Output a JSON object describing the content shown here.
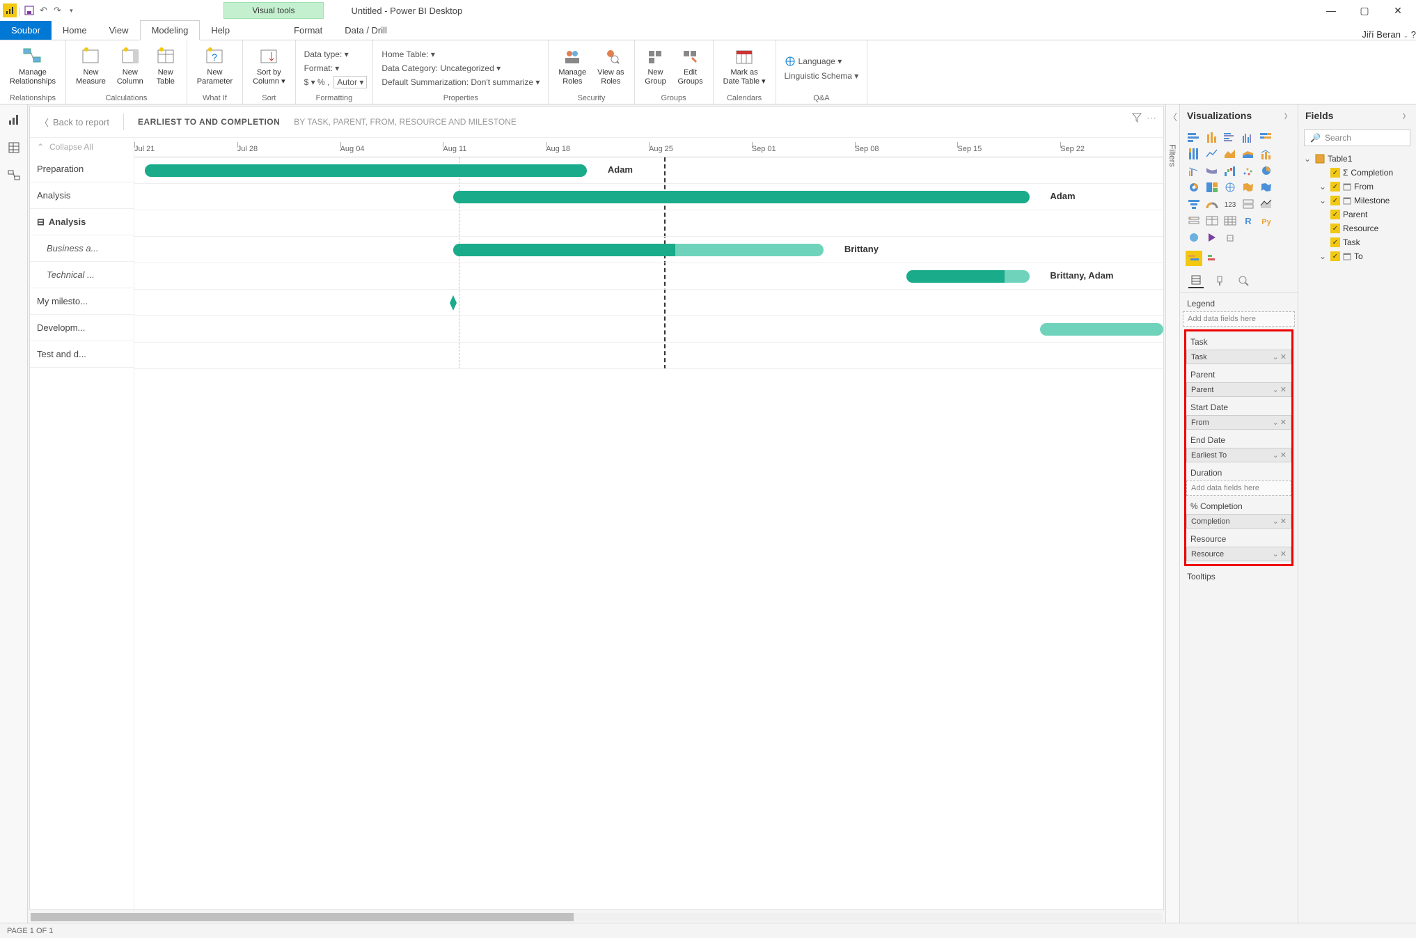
{
  "title_bar": {
    "app_title": "Untitled - Power BI Desktop",
    "visual_tools": "Visual tools",
    "user": "Jiří Beran"
  },
  "ribbon_tabs": {
    "file": "Soubor",
    "home": "Home",
    "view": "View",
    "modeling": "Modeling",
    "help": "Help",
    "format": "Format",
    "data_drill": "Data / Drill"
  },
  "ribbon": {
    "relationships": {
      "manage": "Manage\nRelationships",
      "group": "Relationships"
    },
    "calculations": {
      "new_measure": "New\nMeasure",
      "new_column": "New\nColumn",
      "new_table": "New\nTable",
      "group": "Calculations"
    },
    "whatif": {
      "new_parameter": "New\nParameter",
      "group": "What If"
    },
    "sort": {
      "sort_by_column": "Sort by\nColumn ▾",
      "group": "Sort"
    },
    "formatting": {
      "data_type": "Data type: ▾",
      "format": "Format: ▾",
      "currency_pct": "$ ▾ % , ",
      "auto": "Autor ▾",
      "group": "Formatting"
    },
    "properties": {
      "home_table": "Home Table: ▾",
      "data_category": "Data Category: Uncategorized ▾",
      "default_summarization": "Default Summarization: Don't summarize ▾",
      "group": "Properties"
    },
    "security": {
      "manage_roles": "Manage\nRoles",
      "view_as_roles": "View as\nRoles",
      "group": "Security"
    },
    "groups": {
      "new_group": "New\nGroup",
      "edit_groups": "Edit\nGroups",
      "group": "Groups"
    },
    "calendars": {
      "mark_date": "Mark as\nDate Table ▾",
      "group": "Calendars"
    },
    "qa": {
      "language": "Language ▾",
      "linguistic": "Linguistic Schema ▾",
      "group": "Q&A"
    }
  },
  "filters_label": "Filters",
  "gantt": {
    "back": "Back to report",
    "collapse": "Collapse All",
    "title": "EARLIEST TO AND COMPLETION",
    "subtitle": "BY TASK, PARENT, FROM, RESOURCE AND MILESTONE",
    "timeline": [
      "Jul 21",
      "Jul 28",
      "Aug 04",
      "Aug 11",
      "Aug 18",
      "Aug 25",
      "Sep 01",
      "Sep 08",
      "Sep 15",
      "Sep 22"
    ],
    "rows": [
      {
        "label": "Preparation",
        "type": "task"
      },
      {
        "label": "Analysis",
        "type": "task"
      },
      {
        "label": "Analysis",
        "type": "group"
      },
      {
        "label": "Business a...",
        "type": "sub"
      },
      {
        "label": "Technical ...",
        "type": "sub"
      },
      {
        "label": "My milesto...",
        "type": "task"
      },
      {
        "label": "Developm...",
        "type": "task"
      },
      {
        "label": "Test and d...",
        "type": "task"
      }
    ],
    "bar_labels": {
      "adam": "Adam",
      "brittany": "Brittany",
      "brittany_adam": "Brittany, Adam"
    }
  },
  "viz_pane": {
    "title": "Visualizations",
    "legend": "Legend",
    "add_fields": "Add data fields here",
    "tooltips": "Tooltips",
    "wells": [
      {
        "label": "Task",
        "value": "Task"
      },
      {
        "label": "Parent",
        "value": "Parent"
      },
      {
        "label": "Start Date",
        "value": "From"
      },
      {
        "label": "End Date",
        "value": "Earliest To"
      },
      {
        "label": "Duration",
        "value": null
      },
      {
        "label": "% Completion",
        "value": "Completion"
      },
      {
        "label": "Resource",
        "value": "Resource"
      }
    ]
  },
  "fields_pane": {
    "title": "Fields",
    "search_placeholder": "Search",
    "table": "Table1",
    "fields": [
      {
        "name": "Completion",
        "checked": true,
        "sigma": true,
        "expand": false
      },
      {
        "name": "From",
        "checked": true,
        "date": true,
        "expand": true
      },
      {
        "name": "Milestone",
        "checked": true,
        "date": true,
        "expand": true
      },
      {
        "name": "Parent",
        "checked": true,
        "expand": false
      },
      {
        "name": "Resource",
        "checked": true,
        "expand": false
      },
      {
        "name": "Task",
        "checked": true,
        "expand": false
      },
      {
        "name": "To",
        "checked": true,
        "date": true,
        "expand": true
      }
    ]
  },
  "status_bar": {
    "page": "PAGE 1 OF 1"
  },
  "chart_data": {
    "type": "gantt",
    "x_axis_dates": [
      "Jul 21",
      "Jul 28",
      "Aug 04",
      "Aug 11",
      "Aug 18",
      "Aug 25",
      "Sep 01",
      "Sep 08",
      "Sep 15",
      "Sep 22"
    ],
    "today_marker": "Aug 25",
    "milestone_line": "Aug 11",
    "tasks": [
      {
        "task": "Preparation",
        "start": "Jul 21",
        "end": "Aug 18",
        "completion": 100,
        "resource": "Adam"
      },
      {
        "task": "Analysis",
        "start": "Aug 11",
        "end": "Sep 15",
        "completion": 100,
        "resource": "Adam"
      },
      {
        "task": "Analysis",
        "parent_group": true
      },
      {
        "task": "Business analysis",
        "parent": "Analysis",
        "start": "Aug 11",
        "end": "Sep 05",
        "completion": 60,
        "resource": "Brittany"
      },
      {
        "task": "Technical analysis",
        "parent": "Analysis",
        "start": "Sep 04",
        "end": "Sep 15",
        "completion": 80,
        "resource": "Brittany, Adam"
      },
      {
        "task": "My milestone",
        "milestone": true,
        "date": "Aug 11"
      },
      {
        "task": "Development",
        "start": "Sep 15",
        "end": "Sep 29",
        "completion": 0,
        "resource": ""
      },
      {
        "task": "Test and deployment"
      }
    ]
  }
}
